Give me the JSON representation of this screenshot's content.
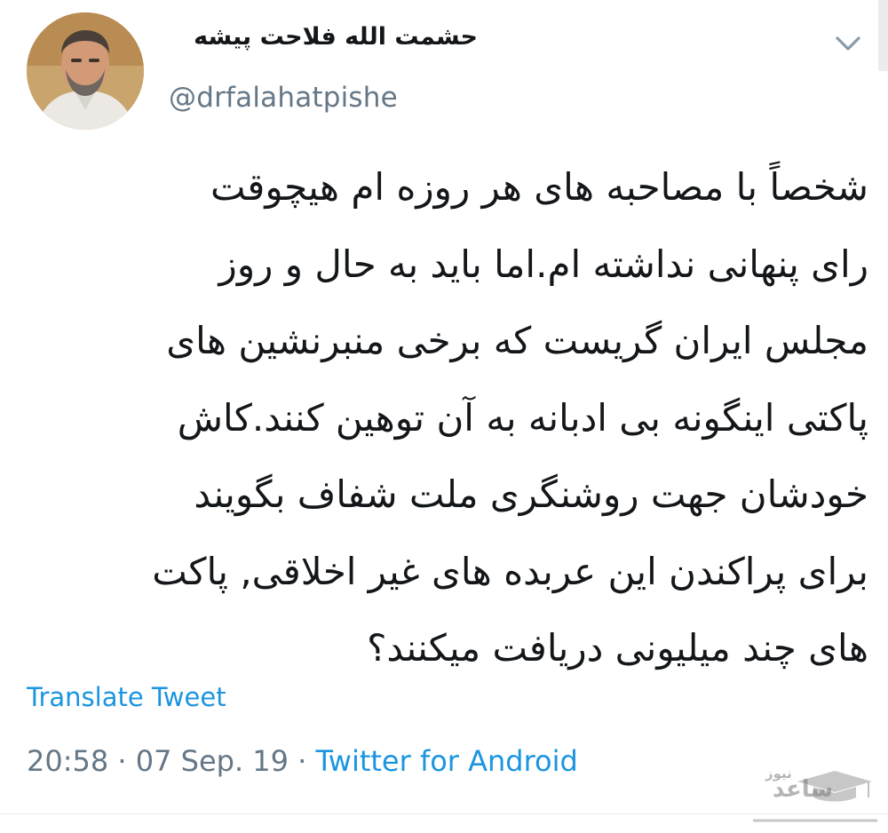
{
  "header": {
    "display_name": "حشمت الله فلاحت پیشه",
    "handle": "@drfalahatpishe",
    "menu_icon": "chevron-down-icon"
  },
  "tweet": {
    "lines": [
      "شخصاً با مصاحبه های هر روزه ام هیچوقت",
      "رای پنهانی نداشته ام.اما باید به حال و روز",
      "مجلس ایران گریست که برخی منبرنشین های",
      "پاکتی اینگونه بی ادبانه به آن توهین کنند.کاش",
      "خودشان جهت روشنگری ملت شفاف بگویند",
      "برای پراکندن این عربده های غیر اخلاقی, پاکت",
      "های چند میلیونی  دریافت میکنند؟"
    ]
  },
  "translate_label": "Translate Tweet",
  "meta": {
    "time": "20:58",
    "separator": " · ",
    "date": "07 Sep. 19",
    "source": "Twitter for Android"
  },
  "watermark": {
    "name": "ساعد",
    "sub": "نیوز",
    "icon": "graduation-cap-icon"
  },
  "colors": {
    "link": "#1b95e0",
    "secondary_text": "#657786",
    "primary_text": "#14171a"
  }
}
